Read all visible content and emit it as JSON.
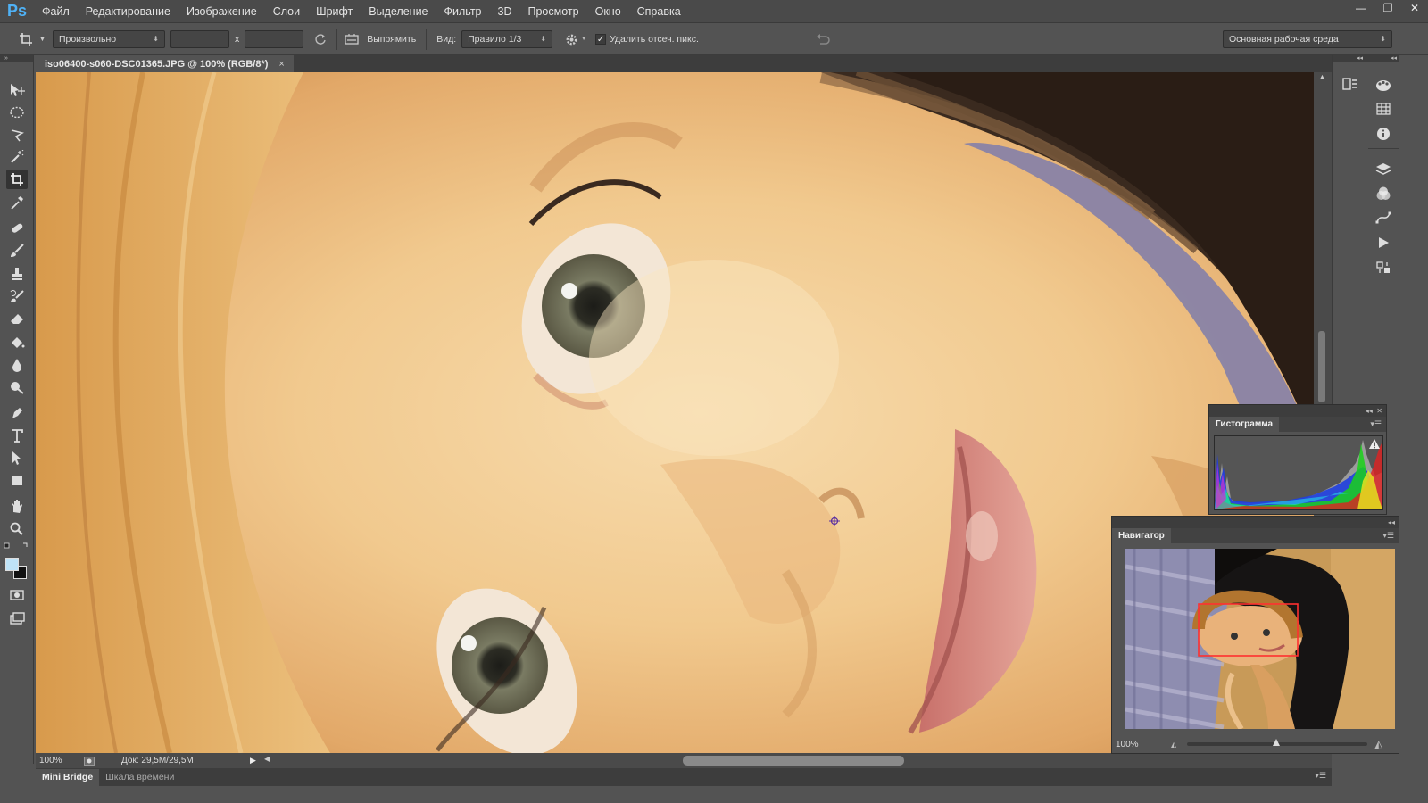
{
  "app": {
    "logo": "Ps"
  },
  "menu": [
    "Файл",
    "Редактирование",
    "Изображение",
    "Слои",
    "Шрифт",
    "Выделение",
    "Фильтр",
    "3D",
    "Просмотр",
    "Окно",
    "Справка"
  ],
  "window_controls": {
    "minimize": "—",
    "restore": "❐",
    "close": "✕"
  },
  "options": {
    "ratio": "Произвольно",
    "times": "x",
    "straighten": "Выпрямить",
    "view_label": "Вид:",
    "view_value": "Правило 1/3",
    "delete_cropped": "Удалить отсеч. пикс.",
    "delete_cropped_checked": true,
    "workspace": "Основная рабочая среда"
  },
  "document": {
    "tab_title": "iso06400-s060-DSC01365.JPG @ 100% (RGB/8*)",
    "close": "×"
  },
  "status": {
    "zoom": "100%",
    "doc_size": "Док: 29,5M/29,5M"
  },
  "bottom_tabs": [
    "Mini Bridge",
    "Шкала времени"
  ],
  "histogram": {
    "title": "Гистограмма"
  },
  "navigator": {
    "title": "Навигатор",
    "zoom": "100%"
  },
  "tools": [
    "move-icon",
    "marquee-ellipse-icon",
    "lasso-icon",
    "magic-wand-icon",
    "crop-icon",
    "eyedropper-icon",
    "healing-brush-icon",
    "brush-icon",
    "clone-stamp-icon",
    "history-brush-icon",
    "eraser-icon",
    "paint-bucket-icon",
    "blur-icon",
    "dodge-icon",
    "pen-icon",
    "type-icon",
    "path-selection-icon",
    "rectangle-icon",
    "hand-icon",
    "zoom-icon"
  ],
  "colors": {
    "foreground": "#bfe3f7",
    "background": "#111111"
  }
}
